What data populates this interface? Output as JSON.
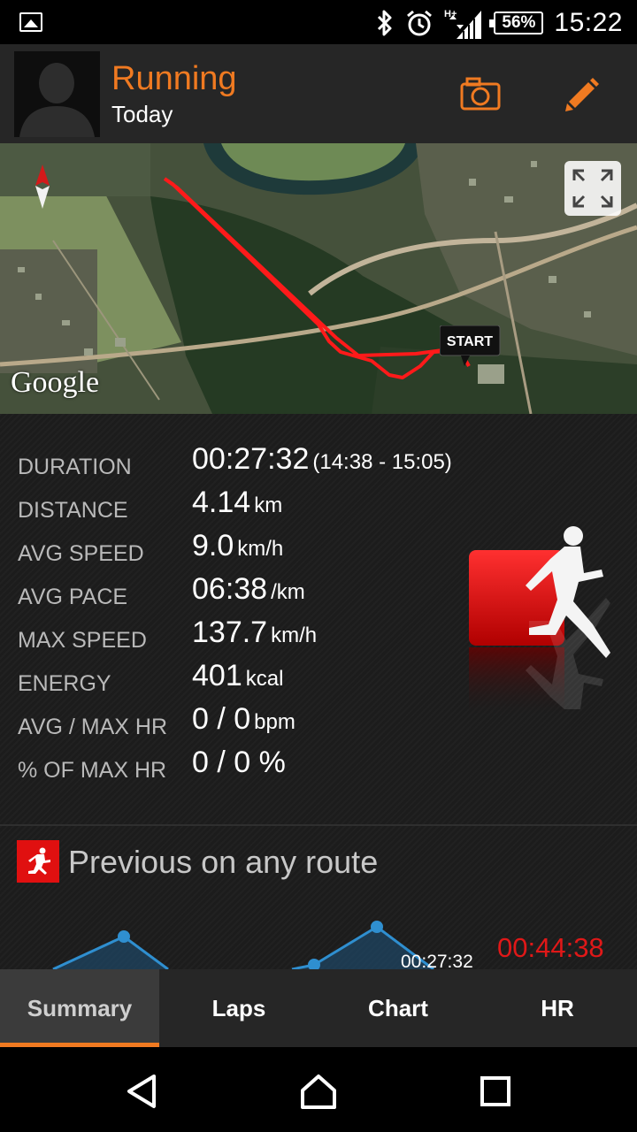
{
  "status_bar": {
    "time": "15:22",
    "battery": "56%",
    "network": "H+",
    "icons": [
      "image-icon",
      "bluetooth-icon",
      "alarm-icon",
      "signal-icon",
      "battery-icon"
    ]
  },
  "header": {
    "title": "Running",
    "subtitle": "Today",
    "camera_icon": "camera-icon",
    "edit_icon": "pencil-icon",
    "accent_color": "#f07a21"
  },
  "map": {
    "start_label": "START",
    "attribution": "Google",
    "compass_icon": "compass-icon",
    "expand_icon": "expand-icon",
    "route_color": "#ff1a1a"
  },
  "stats": [
    {
      "label": "DURATION",
      "value": "00:27:32",
      "unit": "(14:38 - 15:05)"
    },
    {
      "label": "DISTANCE",
      "value": "4.14",
      "unit": "km"
    },
    {
      "label": "AVG SPEED",
      "value": "9.0",
      "unit": "km/h"
    },
    {
      "label": "AVG PACE",
      "value": "06:38",
      "unit": "/km"
    },
    {
      "label": "MAX SPEED",
      "value": "137.7",
      "unit": "km/h"
    },
    {
      "label": "ENERGY",
      "value": "401",
      "unit": "kcal"
    },
    {
      "label": "AVG / MAX HR",
      "value": "0 / 0",
      "unit": "bpm"
    },
    {
      "label": "% OF MAX HR",
      "value": "0 / 0 %",
      "unit": ""
    }
  ],
  "previous": {
    "title": "Previous on any route",
    "time_current": "00:27:32",
    "time_best": "00:44:38"
  },
  "tabs": [
    "Summary",
    "Laps",
    "Chart",
    "HR"
  ],
  "active_tab": "Summary"
}
